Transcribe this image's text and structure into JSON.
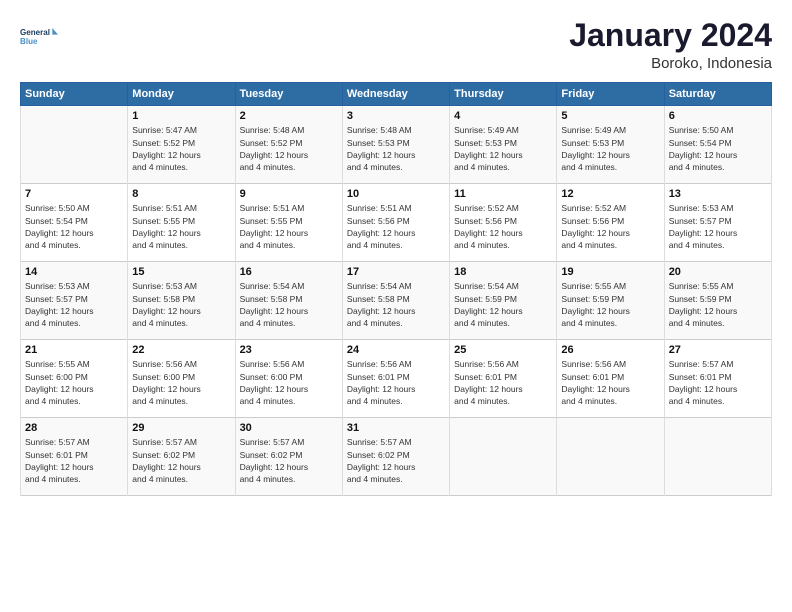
{
  "logo": {
    "line1": "General",
    "line2": "Blue"
  },
  "header": {
    "month": "January 2024",
    "location": "Boroko, Indonesia"
  },
  "days_of_week": [
    "Sunday",
    "Monday",
    "Tuesday",
    "Wednesday",
    "Thursday",
    "Friday",
    "Saturday"
  ],
  "rows": [
    [
      {
        "num": "",
        "info": ""
      },
      {
        "num": "1",
        "info": "Sunrise: 5:47 AM\nSunset: 5:52 PM\nDaylight: 12 hours\nand 4 minutes."
      },
      {
        "num": "2",
        "info": "Sunrise: 5:48 AM\nSunset: 5:52 PM\nDaylight: 12 hours\nand 4 minutes."
      },
      {
        "num": "3",
        "info": "Sunrise: 5:48 AM\nSunset: 5:53 PM\nDaylight: 12 hours\nand 4 minutes."
      },
      {
        "num": "4",
        "info": "Sunrise: 5:49 AM\nSunset: 5:53 PM\nDaylight: 12 hours\nand 4 minutes."
      },
      {
        "num": "5",
        "info": "Sunrise: 5:49 AM\nSunset: 5:53 PM\nDaylight: 12 hours\nand 4 minutes."
      },
      {
        "num": "6",
        "info": "Sunrise: 5:50 AM\nSunset: 5:54 PM\nDaylight: 12 hours\nand 4 minutes."
      }
    ],
    [
      {
        "num": "7",
        "info": "Sunrise: 5:50 AM\nSunset: 5:54 PM\nDaylight: 12 hours\nand 4 minutes."
      },
      {
        "num": "8",
        "info": "Sunrise: 5:51 AM\nSunset: 5:55 PM\nDaylight: 12 hours\nand 4 minutes."
      },
      {
        "num": "9",
        "info": "Sunrise: 5:51 AM\nSunset: 5:55 PM\nDaylight: 12 hours\nand 4 minutes."
      },
      {
        "num": "10",
        "info": "Sunrise: 5:51 AM\nSunset: 5:56 PM\nDaylight: 12 hours\nand 4 minutes."
      },
      {
        "num": "11",
        "info": "Sunrise: 5:52 AM\nSunset: 5:56 PM\nDaylight: 12 hours\nand 4 minutes."
      },
      {
        "num": "12",
        "info": "Sunrise: 5:52 AM\nSunset: 5:56 PM\nDaylight: 12 hours\nand 4 minutes."
      },
      {
        "num": "13",
        "info": "Sunrise: 5:53 AM\nSunset: 5:57 PM\nDaylight: 12 hours\nand 4 minutes."
      }
    ],
    [
      {
        "num": "14",
        "info": "Sunrise: 5:53 AM\nSunset: 5:57 PM\nDaylight: 12 hours\nand 4 minutes."
      },
      {
        "num": "15",
        "info": "Sunrise: 5:53 AM\nSunset: 5:58 PM\nDaylight: 12 hours\nand 4 minutes."
      },
      {
        "num": "16",
        "info": "Sunrise: 5:54 AM\nSunset: 5:58 PM\nDaylight: 12 hours\nand 4 minutes."
      },
      {
        "num": "17",
        "info": "Sunrise: 5:54 AM\nSunset: 5:58 PM\nDaylight: 12 hours\nand 4 minutes."
      },
      {
        "num": "18",
        "info": "Sunrise: 5:54 AM\nSunset: 5:59 PM\nDaylight: 12 hours\nand 4 minutes."
      },
      {
        "num": "19",
        "info": "Sunrise: 5:55 AM\nSunset: 5:59 PM\nDaylight: 12 hours\nand 4 minutes."
      },
      {
        "num": "20",
        "info": "Sunrise: 5:55 AM\nSunset: 5:59 PM\nDaylight: 12 hours\nand 4 minutes."
      }
    ],
    [
      {
        "num": "21",
        "info": "Sunrise: 5:55 AM\nSunset: 6:00 PM\nDaylight: 12 hours\nand 4 minutes."
      },
      {
        "num": "22",
        "info": "Sunrise: 5:56 AM\nSunset: 6:00 PM\nDaylight: 12 hours\nand 4 minutes."
      },
      {
        "num": "23",
        "info": "Sunrise: 5:56 AM\nSunset: 6:00 PM\nDaylight: 12 hours\nand 4 minutes."
      },
      {
        "num": "24",
        "info": "Sunrise: 5:56 AM\nSunset: 6:01 PM\nDaylight: 12 hours\nand 4 minutes."
      },
      {
        "num": "25",
        "info": "Sunrise: 5:56 AM\nSunset: 6:01 PM\nDaylight: 12 hours\nand 4 minutes."
      },
      {
        "num": "26",
        "info": "Sunrise: 5:56 AM\nSunset: 6:01 PM\nDaylight: 12 hours\nand 4 minutes."
      },
      {
        "num": "27",
        "info": "Sunrise: 5:57 AM\nSunset: 6:01 PM\nDaylight: 12 hours\nand 4 minutes."
      }
    ],
    [
      {
        "num": "28",
        "info": "Sunrise: 5:57 AM\nSunset: 6:01 PM\nDaylight: 12 hours\nand 4 minutes."
      },
      {
        "num": "29",
        "info": "Sunrise: 5:57 AM\nSunset: 6:02 PM\nDaylight: 12 hours\nand 4 minutes."
      },
      {
        "num": "30",
        "info": "Sunrise: 5:57 AM\nSunset: 6:02 PM\nDaylight: 12 hours\nand 4 minutes."
      },
      {
        "num": "31",
        "info": "Sunrise: 5:57 AM\nSunset: 6:02 PM\nDaylight: 12 hours\nand 4 minutes."
      },
      {
        "num": "",
        "info": ""
      },
      {
        "num": "",
        "info": ""
      },
      {
        "num": "",
        "info": ""
      }
    ]
  ]
}
